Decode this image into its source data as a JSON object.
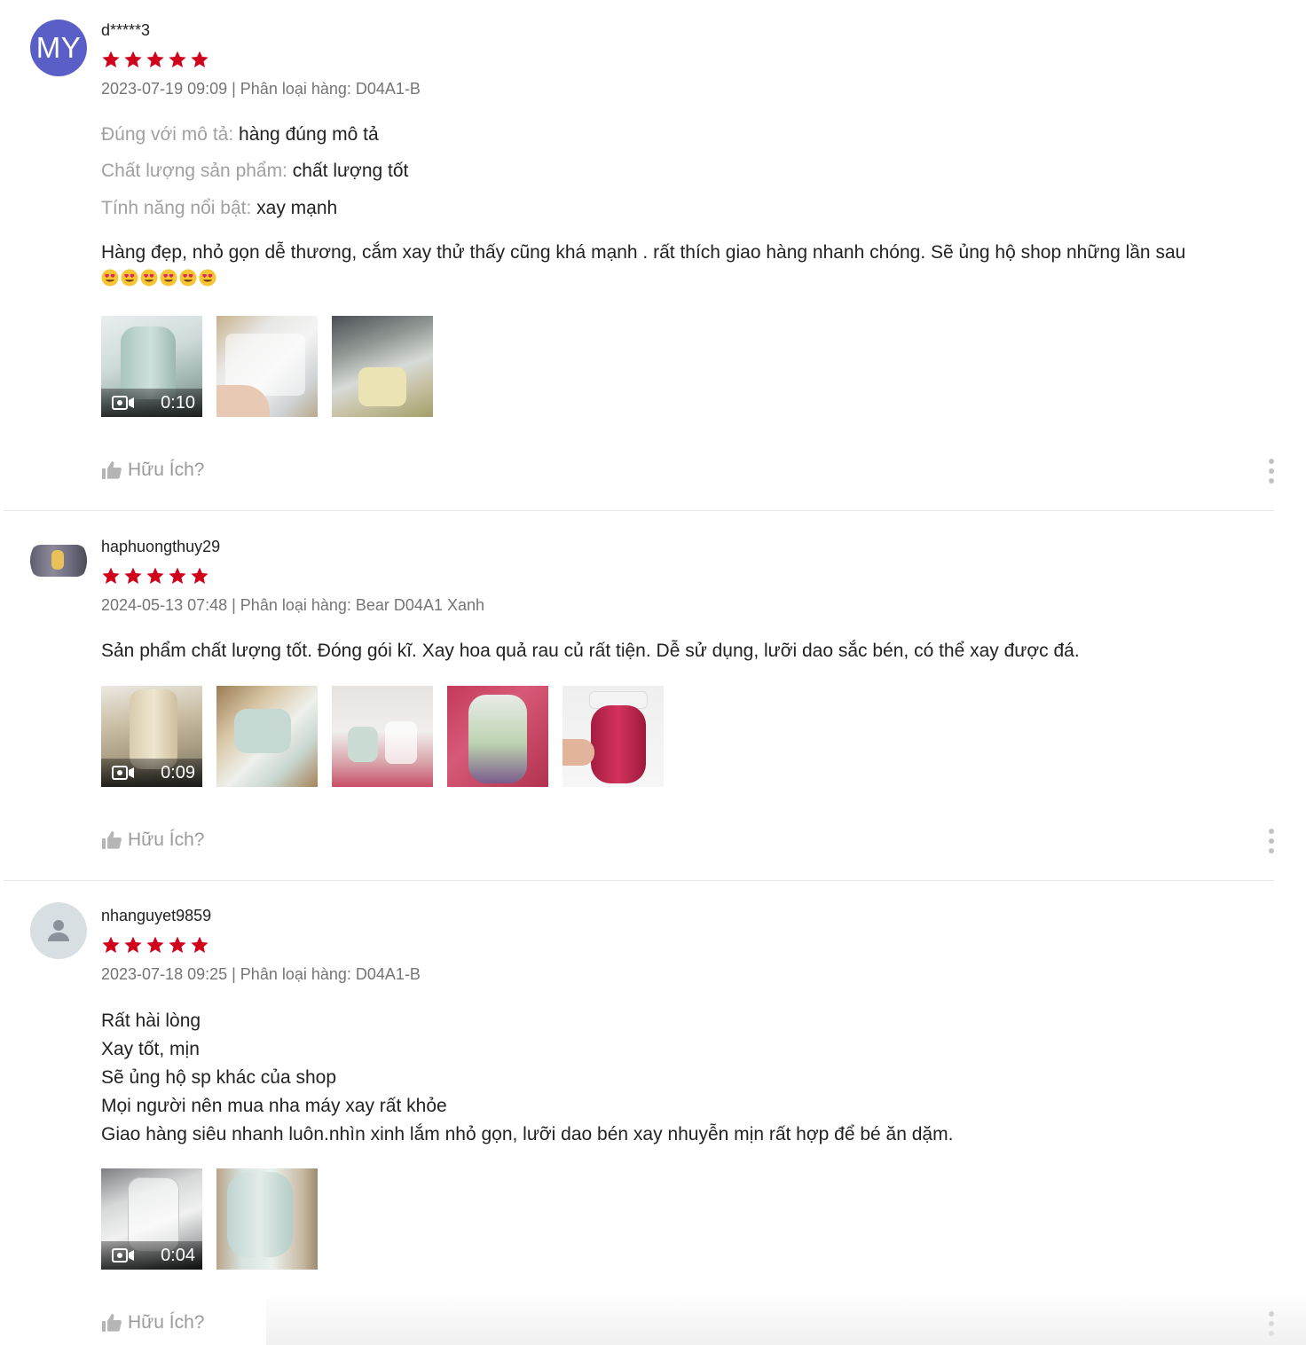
{
  "colors": {
    "star": "#d0011b",
    "avatar_initials_bg": "#5a5fc7",
    "muted": "#757575"
  },
  "helpful_label": "Hữu Ích?",
  "reviews": [
    {
      "avatar_text": "MY",
      "username": "d*****3",
      "rating": 5,
      "meta": "2023-07-19 09:09 | Phân loại hàng: D04A1-B",
      "attributes": [
        {
          "label": "Đúng với mô tả:",
          "value": "hàng đúng mô tả"
        },
        {
          "label": "Chất lượng sản phẩm:",
          "value": "chất lượng tốt"
        },
        {
          "label": "Tính năng nổi bật:",
          "value": "xay mạnh"
        }
      ],
      "text": "Hàng đẹp, nhỏ gọn dễ thương, cắm xay thử thấy cũng khá mạnh . rất thích giao hàng nhanh chóng. Sẽ ủng hộ shop những lần sau",
      "emoji_count": 6,
      "video_duration": "0:10",
      "media_count": 3
    },
    {
      "username": "haphuongthuy29",
      "rating": 5,
      "meta": "2024-05-13 07:48 | Phân loại hàng: Bear D04A1 Xanh",
      "text": "Sản phẩm chất lượng tốt. Đóng gói kĩ. Xay hoa quả rau củ rất tiện. Dễ sử dụng, lưỡi dao sắc bén, có thể xay được đá.",
      "video_duration": "0:09",
      "media_count": 5
    },
    {
      "username": "nhanguyet9859",
      "rating": 5,
      "meta": "2023-07-18 09:25 | Phân loại hàng: D04A1-B",
      "text_lines": [
        "Rất hài lòng",
        "Xay tốt, mịn",
        "Sẽ ủng hộ sp khác của shop",
        "Mọi người nên mua nha máy xay rất khỏe",
        "Giao hàng siêu nhanh luôn.nhìn xinh lắm nhỏ gọn, lưỡi dao bén xay nhuyễn mịn rất hợp để bé ăn dặm."
      ],
      "video_duration": "0:04",
      "media_count": 2
    }
  ]
}
